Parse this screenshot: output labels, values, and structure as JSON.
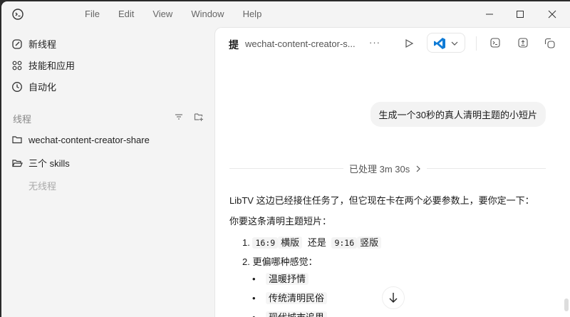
{
  "menu": [
    "File",
    "Edit",
    "View",
    "Window",
    "Help"
  ],
  "sidebar": {
    "items": [
      {
        "label": "新线程"
      },
      {
        "label": "技能和应用"
      },
      {
        "label": "自动化"
      }
    ],
    "section": "线程",
    "projects": [
      {
        "label": "wechat-content-creator-share"
      },
      {
        "label": "三个 skills"
      }
    ],
    "empty": "无线程"
  },
  "header": {
    "prefix": "提",
    "title": "wechat-content-creator-s...",
    "more": "···"
  },
  "chat": {
    "user_msg": "生成一个30秒的真人清明主题的小短片",
    "processed": "已处理 3m 30s",
    "intro": "LibTV 这边已经接住任务了，但它现在卡在两个必要参数上，要你定一下：",
    "q": "你要这条清明主题短片：",
    "l1_num": "1.",
    "l1_a": "16:9",
    "l1_a2": "横版",
    "l1_or": "还是",
    "l1_b": "9:16",
    "l1_b2": "竖版",
    "l2": "2. 更偏哪种感觉：",
    "bullets": [
      "温暖抒情",
      "传统清明民俗",
      "现代城市追思"
    ]
  },
  "colors": {
    "accent": "#0f7bd6"
  }
}
